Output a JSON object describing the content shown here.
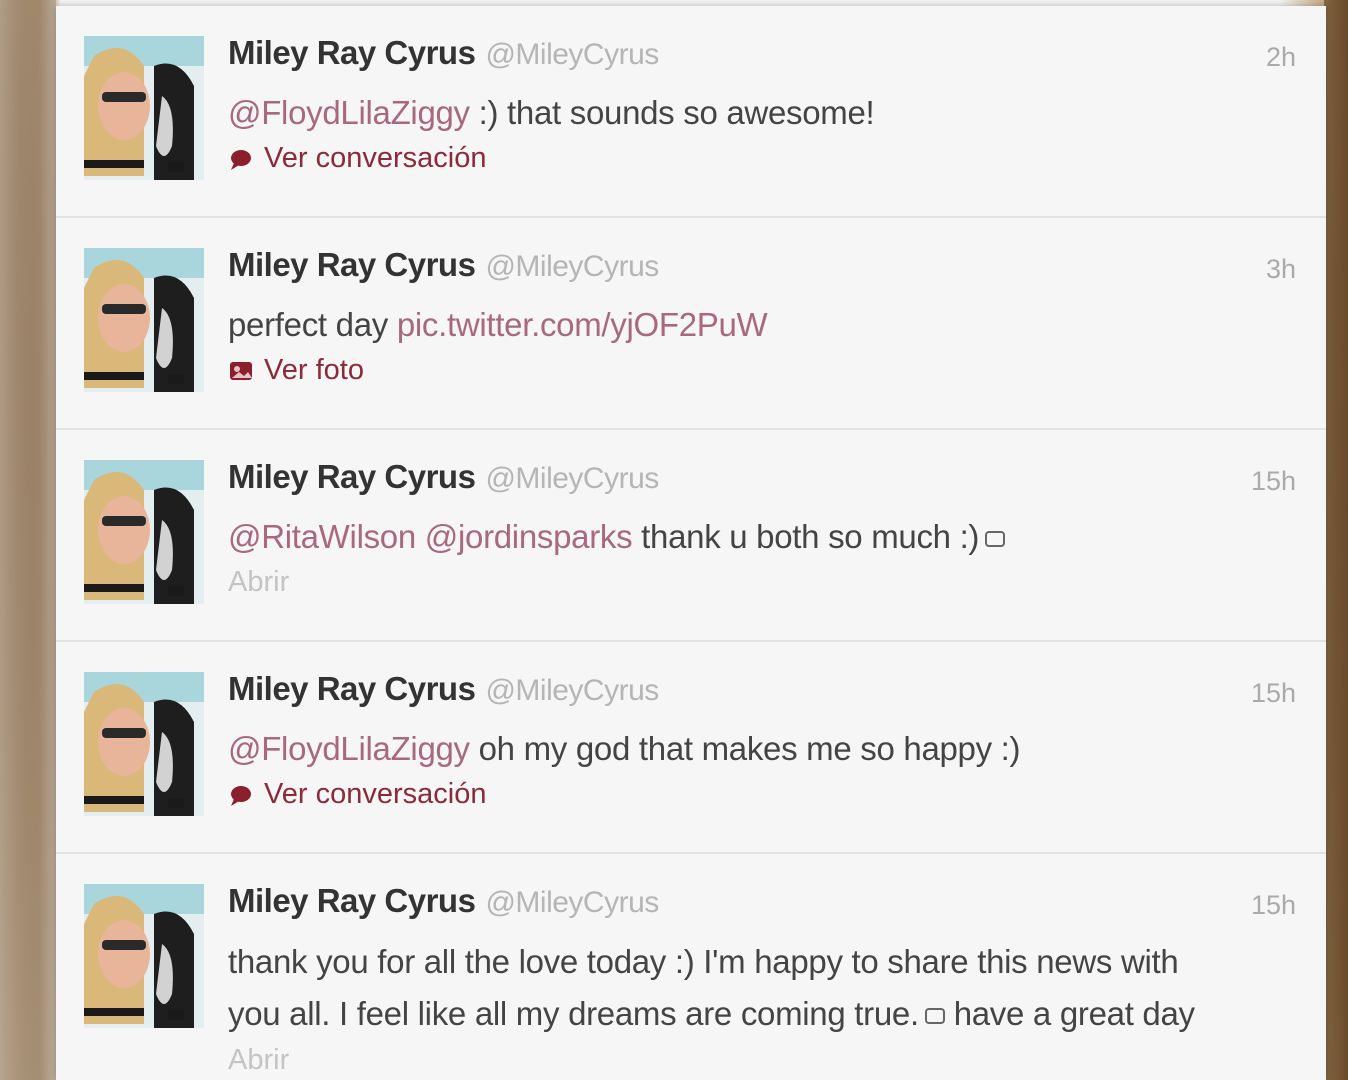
{
  "colors": {
    "background": "#f4f4f4",
    "name": "#333333",
    "handle": "#b5b5b5",
    "mention_link": "#a8697d",
    "action": "#8b2b3a",
    "muted": "#c4c4c4"
  },
  "tweets": [
    {
      "name": "Miley Ray Cyrus",
      "handle": "@MileyCyrus",
      "time": "2h",
      "text_parts": [
        "@FloydLilaZiggy",
        " :) that sounds so awesome!"
      ],
      "action_icon": "speech-bubble-icon",
      "action": "Ver conversación"
    },
    {
      "name": "Miley Ray Cyrus",
      "handle": "@MileyCyrus",
      "time": "3h",
      "text_parts": [
        "perfect day ",
        "pic.twitter.com/yjOF2PuW"
      ],
      "action_icon": "photo-icon",
      "action": "Ver foto"
    },
    {
      "name": "Miley Ray Cyrus",
      "handle": "@MileyCyrus",
      "time": "15h",
      "text_parts": [
        "@RitaWilson",
        "@jordinsparks",
        " thank u both so much :)"
      ],
      "action": "Abrir"
    },
    {
      "name": "Miley Ray Cyrus",
      "handle": "@MileyCyrus",
      "time": "15h",
      "text_parts": [
        "@FloydLilaZiggy",
        " oh my god that makes me so happy :)"
      ],
      "action_icon": "speech-bubble-icon",
      "action": "Ver conversación"
    },
    {
      "name": "Miley Ray Cyrus",
      "handle": "@MileyCyrus",
      "time": "15h",
      "text_lines": [
        "thank you for all the love today :) I'm happy to share this news with",
        "you all. I feel like all my dreams are coming true.",
        " have a great day"
      ],
      "action": "Abrir"
    }
  ]
}
